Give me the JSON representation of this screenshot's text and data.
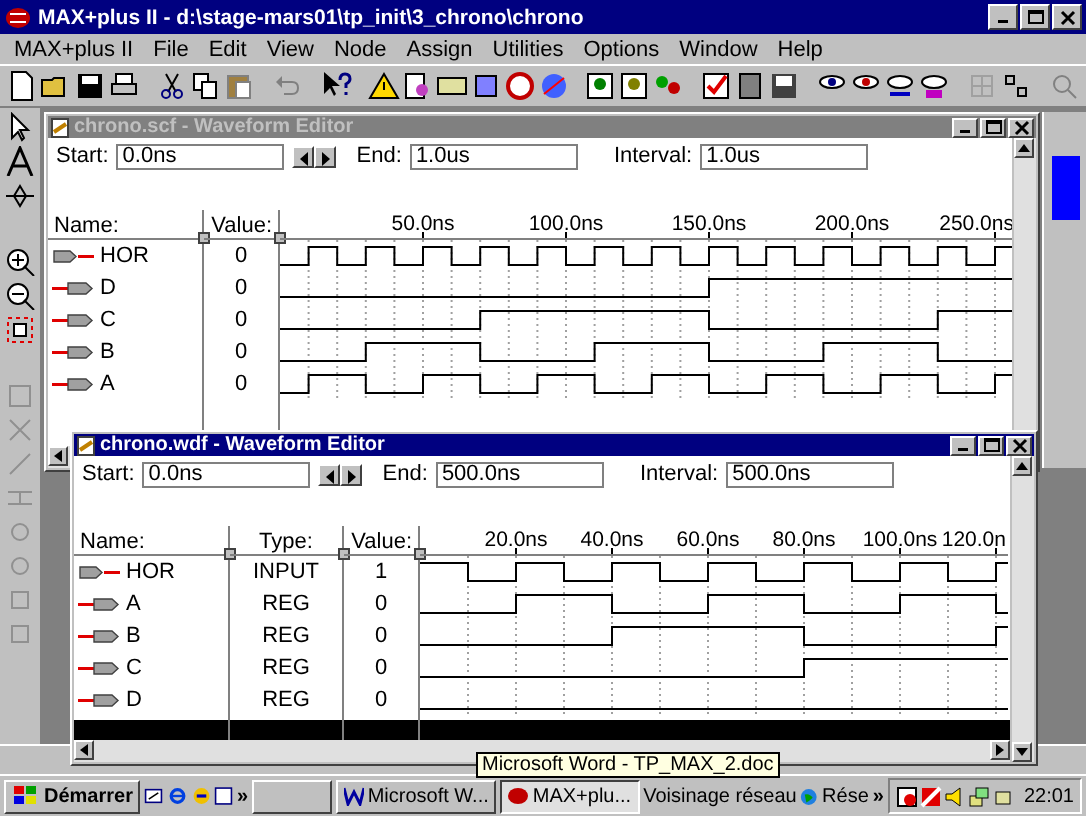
{
  "app": {
    "title": "MAX+plus II - d:\\stage-mars01\\tp_init\\3_chrono\\chrono"
  },
  "menu": [
    "MAX+plus II",
    "File",
    "Edit",
    "View",
    "Node",
    "Assign",
    "Utilities",
    "Options",
    "Window",
    "Help"
  ],
  "editors": [
    {
      "title": "chrono.scf - Waveform Editor",
      "active": false,
      "start_label": "Start:",
      "start": "0.0ns",
      "end_label": "End:",
      "end": "1.0us",
      "interval_label": "Interval:",
      "interval": "1.0us",
      "columns": [
        "Name:",
        "Value:"
      ],
      "ticks": [
        "50.0ns",
        "100.0ns",
        "150.0ns",
        "200.0ns",
        "250.0ns"
      ],
      "signals": [
        {
          "name": "HOR",
          "kind": "input",
          "value": "0"
        },
        {
          "name": "D",
          "kind": "output",
          "value": "0"
        },
        {
          "name": "C",
          "kind": "output",
          "value": "0"
        },
        {
          "name": "B",
          "kind": "output",
          "value": "0"
        },
        {
          "name": "A",
          "kind": "output",
          "value": "0"
        }
      ]
    },
    {
      "title": "chrono.wdf - Waveform Editor",
      "active": true,
      "start_label": "Start:",
      "start": "0.0ns",
      "end_label": "End:",
      "end": "500.0ns",
      "interval_label": "Interval:",
      "interval": "500.0ns",
      "columns": [
        "Name:",
        "Type:",
        "Value:"
      ],
      "ticks": [
        "20.0ns",
        "40.0ns",
        "60.0ns",
        "80.0ns",
        "100.0ns",
        "120.0n"
      ],
      "signals": [
        {
          "name": "HOR",
          "kind": "input",
          "type": "INPUT",
          "value": "1"
        },
        {
          "name": "A",
          "kind": "output",
          "type": "REG",
          "value": "0"
        },
        {
          "name": "B",
          "kind": "output",
          "type": "REG",
          "value": "0"
        },
        {
          "name": "C",
          "kind": "output",
          "type": "REG",
          "value": "0"
        },
        {
          "name": "D",
          "kind": "output",
          "type": "REG",
          "value": "0"
        }
      ]
    }
  ],
  "taskbar": {
    "start": "Démarrer",
    "quick_more": "»",
    "buttons": [
      {
        "label": "Microsoft W...",
        "selected": false
      },
      {
        "label": "MAX+plu...",
        "selected": true
      }
    ],
    "toolbar_label": "Voisinage réseau",
    "network": "Rése",
    "toolbar_more": "»",
    "clock": "22:01"
  },
  "tooltip": "Microsoft Word - TP_MAX_2.doc"
}
